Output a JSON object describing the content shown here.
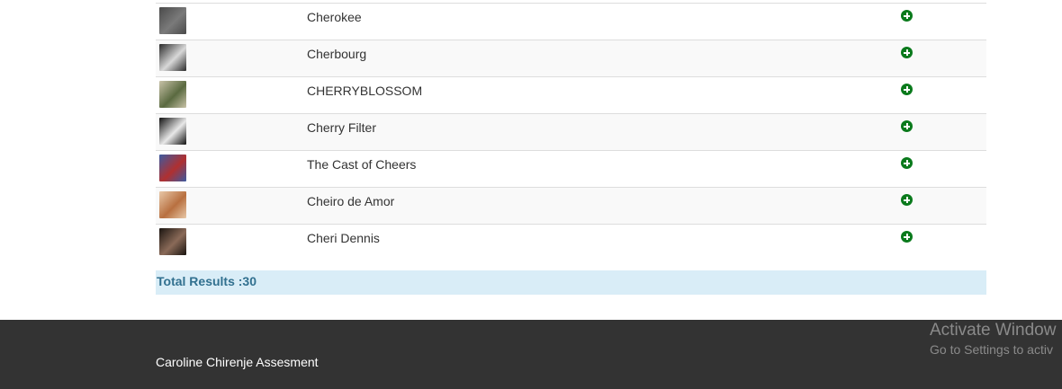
{
  "results": [
    {
      "name": "Cherokee",
      "thumb_colors": [
        "#4a4a4a",
        "#7a7a7a"
      ],
      "add_icon": "plus-circle-icon"
    },
    {
      "name": "Cherbourg",
      "thumb_colors": [
        "#2b2b2b",
        "#d8d8d8"
      ],
      "add_icon": "plus-circle-icon"
    },
    {
      "name": "CHERRYBLOSSOM",
      "thumb_colors": [
        "#c8c2a8",
        "#5a6a40"
      ],
      "add_icon": "plus-circle-icon"
    },
    {
      "name": "Cherry Filter",
      "thumb_colors": [
        "#111111",
        "#e8e8e8"
      ],
      "add_icon": "plus-circle-icon"
    },
    {
      "name": "The Cast of Cheers",
      "thumb_colors": [
        "#3c5aa0",
        "#b03030"
      ],
      "add_icon": "plus-circle-icon"
    },
    {
      "name": "Cheiro de Amor",
      "thumb_colors": [
        "#e8c8a8",
        "#b87040"
      ],
      "add_icon": "plus-circle-icon"
    },
    {
      "name": "Cheri Dennis",
      "thumb_colors": [
        "#1a1410",
        "#8a6a58"
      ],
      "add_icon": "plus-circle-icon"
    }
  ],
  "summary": {
    "total_label": "Total Results :30"
  },
  "footer": {
    "credit": "Caroline Chirenje Assesment"
  },
  "watermark": {
    "title": "Activate Window",
    "subtitle": "Go to Settings to activ"
  },
  "colors": {
    "add_icon": "#0a7a1c",
    "total_bar_bg": "#d9edf7",
    "total_text": "#31708f",
    "footer_bg": "#333333"
  }
}
